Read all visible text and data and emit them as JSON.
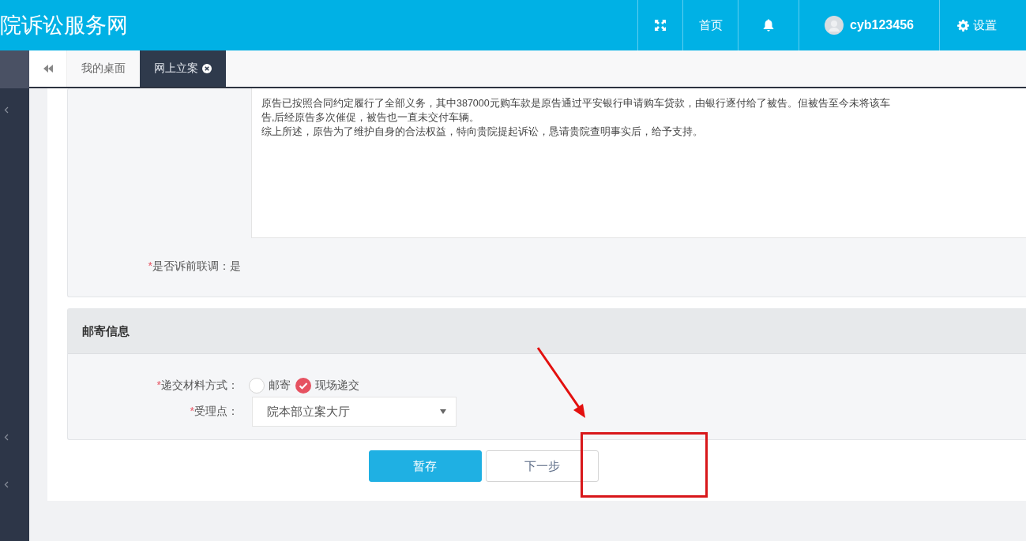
{
  "header": {
    "title": "院诉讼服务网",
    "nav": [
      {
        "kind": "fullscreen"
      },
      {
        "kind": "link",
        "label": "首页"
      },
      {
        "kind": "bell"
      },
      {
        "kind": "user",
        "label": "cyb123456"
      },
      {
        "kind": "settings",
        "label": "设置"
      }
    ]
  },
  "tabs": [
    {
      "label": "我的桌面",
      "selected": false,
      "closable": false
    },
    {
      "label": "网上立案",
      "selected": true,
      "closable": true
    }
  ],
  "claim_section": {
    "text_lines": [
      "原告已按照合同约定履行了全部义务，其中387000元购车款是原告通过平安银行申请购车贷款，由银行逐付给了被告。但被告至今未将该车",
      "告,后经原告多次催促，被告也一直未交付车辆。",
      "综上所述，原告为了维护自身的合法权益，特向贵院提起诉讼，恳请贵院查明事实后，给予支持。"
    ],
    "field": {
      "mark": "*",
      "label": "是否诉前联调：",
      "value": "是"
    }
  },
  "mail_section": {
    "title": "邮寄信息",
    "delivery": {
      "mark": "*",
      "label": "递交材料方式：",
      "options": [
        {
          "label": "邮寄",
          "selected": false
        },
        {
          "label": "现场递交",
          "selected": true
        }
      ]
    },
    "office": {
      "mark": "*",
      "label": "受理点：",
      "value": "院本部立案大厅"
    }
  },
  "buttons": [
    {
      "label": "暂存",
      "kind": "primary"
    },
    {
      "label": "下一步",
      "kind": "default"
    }
  ]
}
